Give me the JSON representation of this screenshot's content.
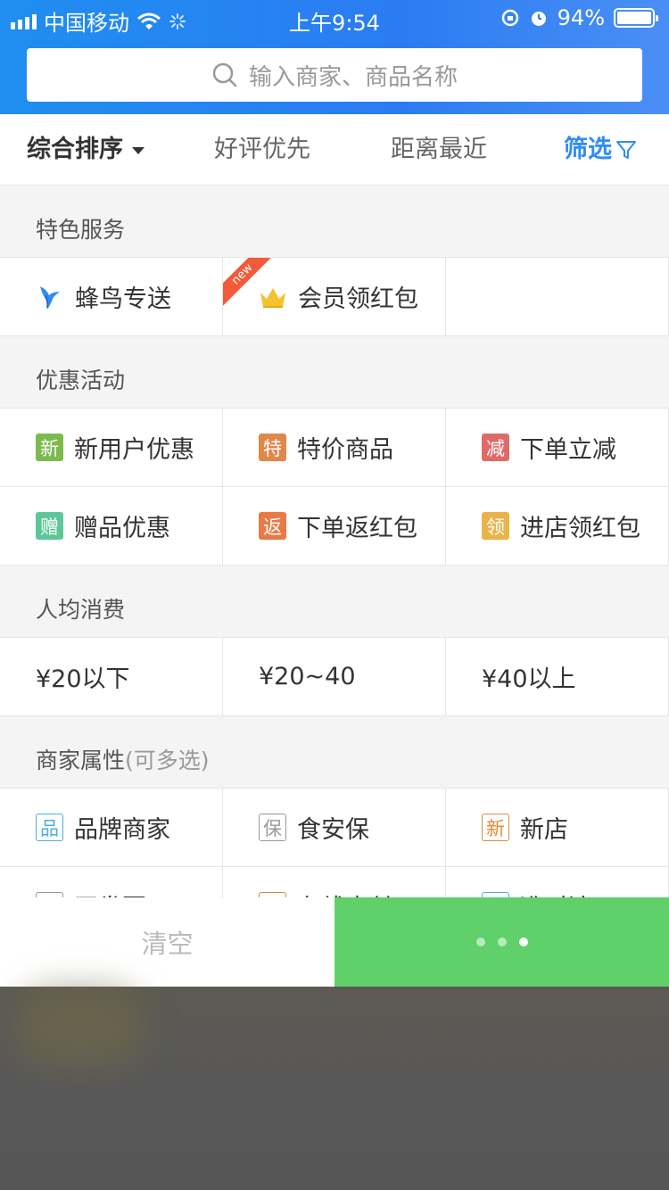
{
  "status_bar": {
    "carrier": "中国移动",
    "time": "上午9:54",
    "battery": "94%"
  },
  "search": {
    "placeholder": "输入商家、商品名称"
  },
  "sort_bar": {
    "main": "综合排序",
    "good": "好评优先",
    "near": "距离最近",
    "filter": "筛选"
  },
  "sections": {
    "special": {
      "title": "特色服务",
      "items": [
        {
          "label": "蜂鸟专送",
          "icon": "hummingbird-icon"
        },
        {
          "label": "会员领红包",
          "icon": "crown-icon",
          "ribbon": "new"
        }
      ]
    },
    "promo": {
      "title": "优惠活动",
      "items": [
        {
          "label": "新用户优惠",
          "badge": "新",
          "color": "#7cba4d"
        },
        {
          "label": "特价商品",
          "badge": "特",
          "color": "#e0874a"
        },
        {
          "label": "下单立减",
          "badge": "减",
          "color": "#e06a6a"
        },
        {
          "label": "赠品优惠",
          "badge": "赠",
          "color": "#5ec79a"
        },
        {
          "label": "下单返红包",
          "badge": "返",
          "color": "#e87a45"
        },
        {
          "label": "进店领红包",
          "badge": "领",
          "color": "#eab34a"
        }
      ]
    },
    "price": {
      "title": "人均消费",
      "items": [
        {
          "label": "¥20以下"
        },
        {
          "label": "¥20~40"
        },
        {
          "label": "¥40以上"
        }
      ]
    },
    "attr": {
      "title": "商家属性",
      "subtitle": "(可多选)",
      "items": [
        {
          "label": "品牌商家",
          "badge": "品",
          "color": "#4aaee0"
        },
        {
          "label": "食安保",
          "badge": "保",
          "color": "#999999"
        },
        {
          "label": "新店",
          "badge": "新",
          "color": "#e08a3a"
        },
        {
          "label": "开发票",
          "badge": "票",
          "color": "#999999"
        },
        {
          "label": "在线支付",
          "badge": "付",
          "color": "#e08a3a"
        },
        {
          "label": "准时达",
          "badge": "准",
          "color": "#4aaee0"
        }
      ]
    }
  },
  "footer": {
    "clear": "清空"
  }
}
